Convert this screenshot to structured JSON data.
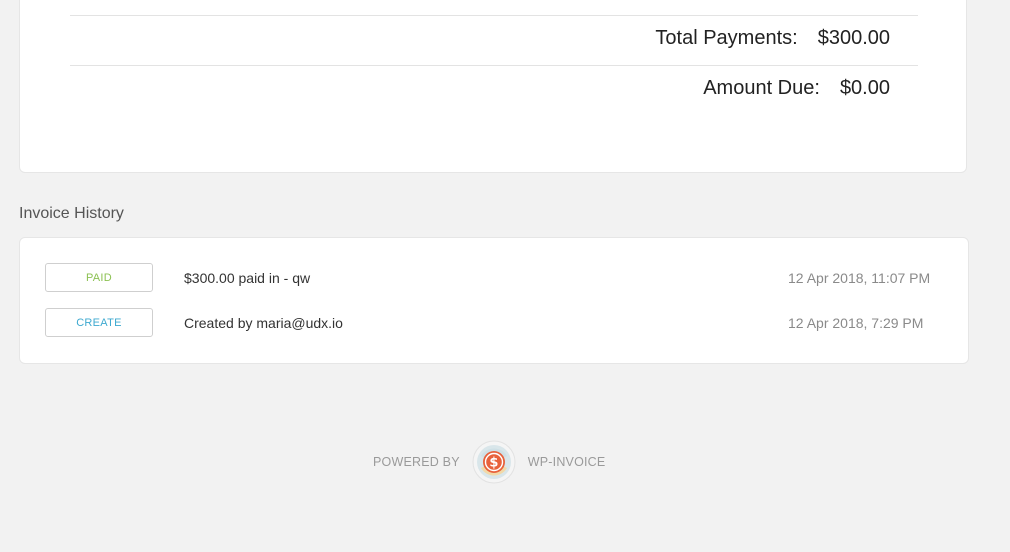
{
  "summary": {
    "total_payments_label": "Total Payments:",
    "total_payments_value": "$300.00",
    "amount_due_label": "Amount Due:",
    "amount_due_value": "$0.00"
  },
  "history": {
    "title": "Invoice History",
    "rows": [
      {
        "badge": "PAID",
        "badge_color": "#8cc152",
        "description": "$300.00 paid in - qw",
        "date": "12 Apr 2018, 11:07 PM"
      },
      {
        "badge": "CREATE",
        "badge_color": "#3ea9d0",
        "description": "Created by maria@udx.io",
        "date": "12 Apr 2018, 7:29 PM"
      }
    ]
  },
  "footer": {
    "powered_by": "POWERED BY",
    "brand": "WP-INVOICE",
    "logo_icon": "dollar-coin-icon",
    "logo_color": "#e8623c"
  }
}
